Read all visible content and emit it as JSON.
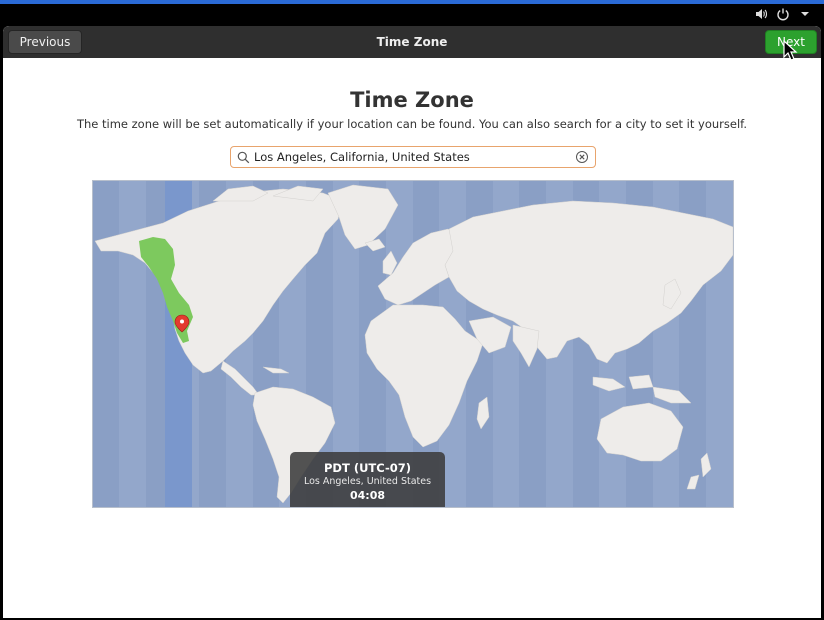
{
  "system_tray": {
    "icons": [
      "volume-icon",
      "power-icon",
      "chevron-down-icon"
    ]
  },
  "headerbar": {
    "previous_label": "Previous",
    "title": "Time Zone",
    "next_label": "Next"
  },
  "page": {
    "title": "Time Zone",
    "description": "The time zone will be set automatically if your location can be found. You can also search for a city to set it yourself."
  },
  "search": {
    "value": "Los Angeles, California, United States",
    "icon": "search-icon",
    "clear_icon": "clear-icon"
  },
  "map": {
    "selected_zone_color": "#7dc95e",
    "highlight_band_color": "#7a97cc",
    "tooltip": {
      "zone": "PDT (UTC-07)",
      "city": "Los Angeles, United States",
      "time": "04:08"
    }
  },
  "colors": {
    "accent": "#2a6ad6",
    "next_button": "#2ca12e",
    "headerbar": "#2f2f2f",
    "ocean": "#93a7cb",
    "land": "#eeecea"
  }
}
